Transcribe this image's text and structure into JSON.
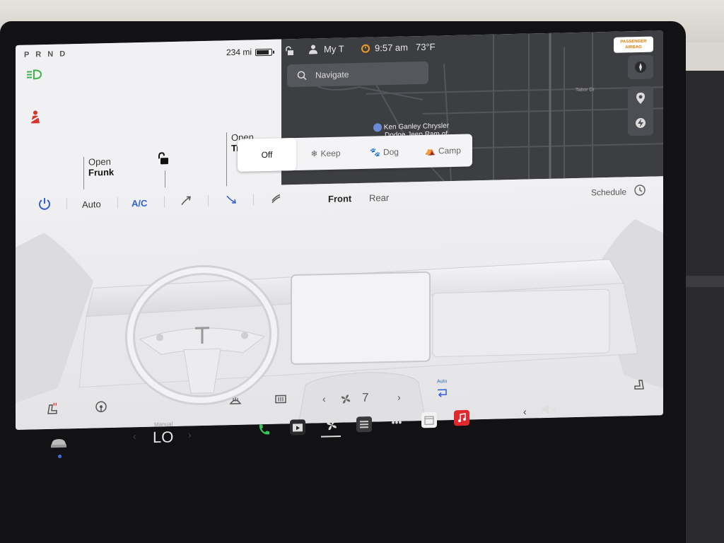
{
  "car_status": {
    "gear": "P R N D",
    "range": "234 mi",
    "battery_fraction": 0.85,
    "frunk": {
      "line1": "Open",
      "line2": "Frunk"
    },
    "trunk": {
      "line1": "Open",
      "line2": "Tr"
    }
  },
  "status_bar": {
    "profile": "My T",
    "time": "9:57 am",
    "temperature": "73°F"
  },
  "map": {
    "search_placeholder": "Navigate",
    "poi_line1": "Ken Ganley Chrysler",
    "poi_line2": "Dodge Jeep Ram of",
    "street_label": "Tabor Dr",
    "airbag_line1": "PASSENGER",
    "airbag_line2": "AIRBAG"
  },
  "climate_modes": {
    "items": [
      "Off",
      "Keep",
      "Dog",
      "Camp"
    ],
    "selected": "Off"
  },
  "climate": {
    "auto": "Auto",
    "ac": "A/C",
    "front": "Front",
    "rear": "Rear",
    "schedule": "Schedule",
    "fan_speed": "7",
    "fan_mode_label": "Auto",
    "accent_color": "#2f5ed6"
  },
  "taskbar": {
    "temp_mode": "Manual",
    "temp_value": "LO",
    "apps": [
      "phone-icon",
      "theater-icon",
      "fan-icon",
      "media-icon",
      "more-icon",
      "calendar-icon",
      "music-icon"
    ],
    "volume": "muted"
  }
}
